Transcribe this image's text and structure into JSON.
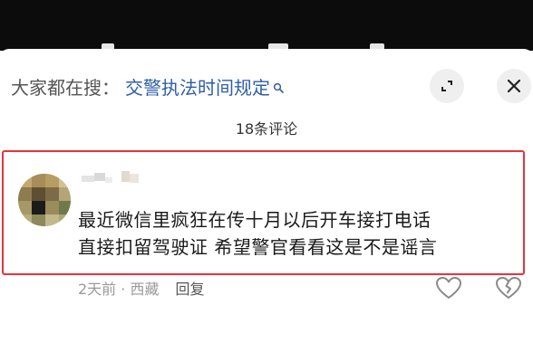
{
  "search": {
    "prefix": "大家都在搜：",
    "query": "交警执法时间规定"
  },
  "comments": {
    "count_label": "18条评论"
  },
  "comment": {
    "text_line1": "最近微信里疯狂在传十月以后开车接打电话",
    "text_line2": "直接扣留驾驶证  希望警官看看这是不是谣言",
    "time_location": "2天前 · 西藏",
    "reply_label": "回复"
  },
  "icons": {
    "search_hint": "search-icon",
    "expand": "expand-icon",
    "close": "close-icon",
    "like": "heart-icon",
    "dislike": "broken-heart-icon"
  },
  "colors": {
    "accent_link": "#2f5ea8",
    "highlight_border": "#e8323c"
  }
}
